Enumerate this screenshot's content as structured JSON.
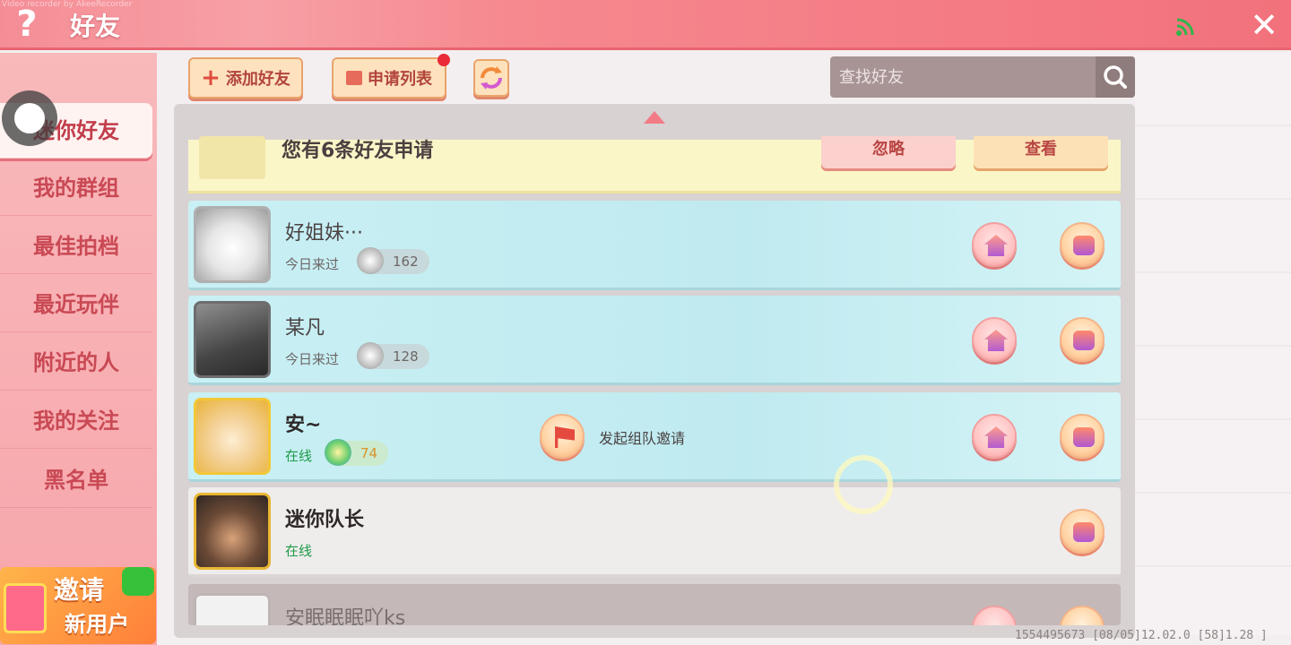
{
  "header": {
    "help_label": "?",
    "title": "好友",
    "close_label": "✕",
    "watermark": "Video recorder by AkeeRecorder"
  },
  "sidebar": {
    "items": [
      {
        "label": "迷你好友",
        "active": true
      },
      {
        "label": "我的群组"
      },
      {
        "label": "最佳拍档"
      },
      {
        "label": "最近玩伴"
      },
      {
        "label": "附近的人"
      },
      {
        "label": "我的关注"
      },
      {
        "label": "黑名单"
      }
    ],
    "invite": {
      "line1": "邀请",
      "line2": "新用户"
    }
  },
  "toolbar": {
    "add_friend_label": "添加好友",
    "request_list_label": "申请列表",
    "search_placeholder": "查找好友"
  },
  "request_banner": {
    "text": "您有6条好友申请",
    "ignore_label": "忽略",
    "view_label": "查看"
  },
  "friends": [
    {
      "name": "好姐妹···",
      "status": "今日来过",
      "level": "162"
    },
    {
      "name": "某凡",
      "status": "今日来过",
      "level": "128"
    },
    {
      "name": "安~",
      "status": "在线",
      "level": "74",
      "team_invite_label": "发起组队邀请"
    },
    {
      "name": "迷你队长",
      "status": "在线"
    },
    {
      "name": "安眠眠眠吖ks"
    }
  ],
  "footer": {
    "id_text": "1554495673   [08/05]12.02.0   [58]1.28 ]"
  },
  "colors": {
    "header": "#f2717c",
    "sidebar": "#f8b9bb",
    "accent": "#c94954",
    "online": "#1f9a4a"
  }
}
